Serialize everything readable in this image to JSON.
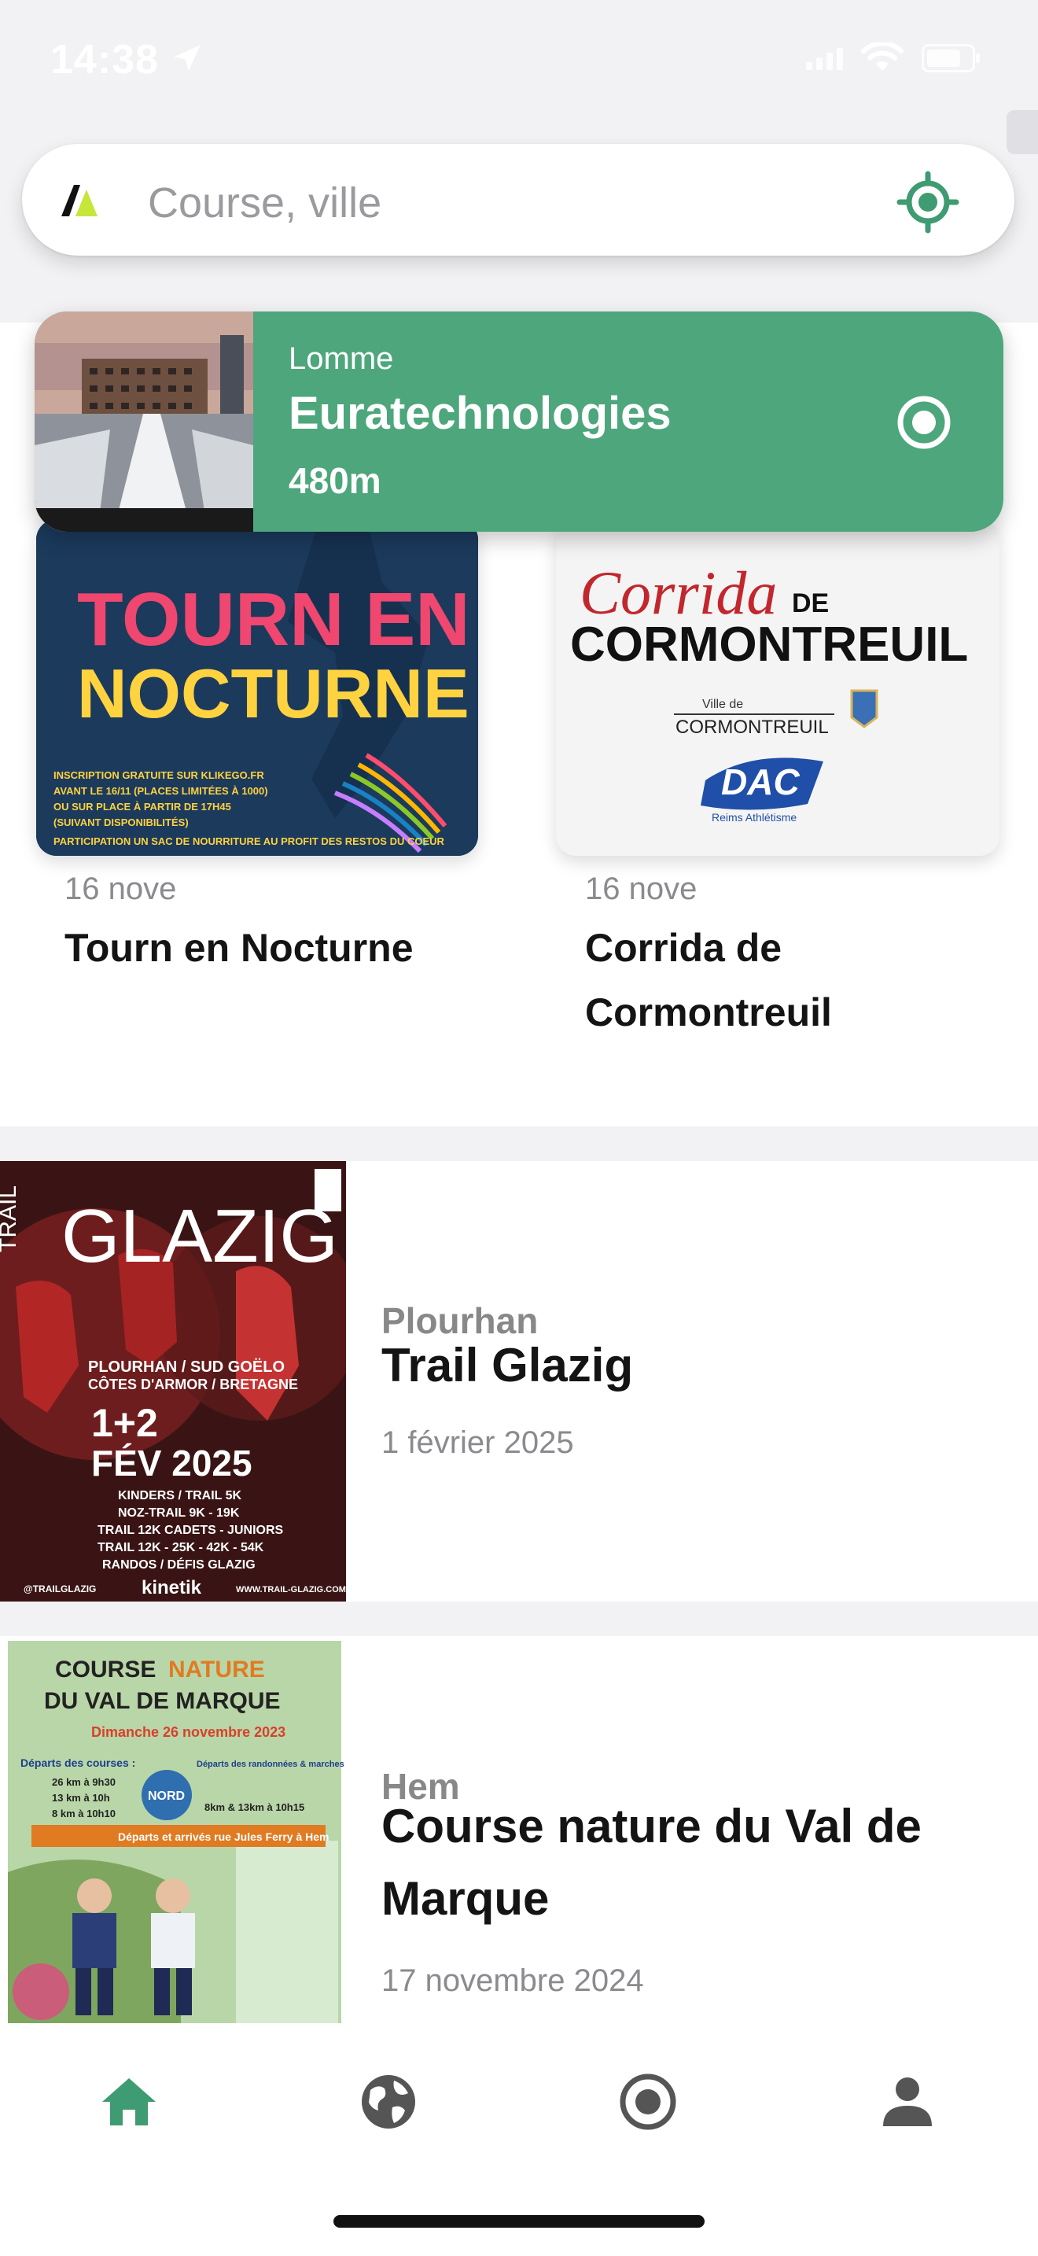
{
  "status_bar": {
    "time": "14:38"
  },
  "search": {
    "placeholder": "Course, ville"
  },
  "nearby": {
    "city": "Lomme",
    "name": "Euratechnologies",
    "distance": "480m"
  },
  "cards": [
    {
      "date": "16 nove",
      "title": "Tourn en Nocturne",
      "poster": {
        "headline_1": "TOURN EN",
        "headline_2": "NOCTURNE",
        "lines": [
          "INSCRIPTION GRATUITE SUR KLIKEGO.FR",
          "AVANT LE 16/11 (PLACES LIMITÉES À 1000)",
          "OU SUR PLACE À PARTIR DE 17H45",
          "(SUIVANT DISPONIBILITÉS)",
          "PARTICIPATION UN SAC DE NOURRITURE AU PROFIT DES RESTOS DU COEUR"
        ]
      }
    },
    {
      "date": "16 nove",
      "title": "Corrida de Cormontreuil",
      "poster": {
        "script": "Corrida",
        "de": "DE",
        "headline": "CORMONTREUIL",
        "ville_de": "Ville de",
        "ville": "CORMONTREUIL",
        "club": "DAC",
        "club_sub": "Reims Athlétisme"
      }
    }
  ],
  "events": [
    {
      "city": "Plourhan",
      "title": "Trail Glazig",
      "date": "1 février 2025",
      "poster": {
        "trail": "TRAIL",
        "name": "GLAZIG",
        "place_1": "PLOURHAN / SUD GOËLO",
        "place_2": "CÔTES D'ARMOR / BRETAGNE",
        "days": "1+2",
        "month": "FÉV 2025",
        "lines": [
          "KINDERS / TRAIL 5K",
          "NOZ-TRAIL 9K - 19K",
          "TRAIL 12K CADETS - JUNIORS",
          "TRAIL 12K - 25K - 42K - 54K",
          "RANDOS / DÉFIS GLAZIG"
        ],
        "footer_left": "@TRAILGLAZIG",
        "footer_mid": "kinetik",
        "footer_right": "WWW.TRAIL-GLAZIG.COM"
      }
    },
    {
      "city": "Hem",
      "title": "Course nature du Val de Marque",
      "date": "17 novembre 2024",
      "poster": {
        "line_1a": "COURSE",
        "line_1b": "NATURE",
        "line_2": "DU VAL DE MARQUE",
        "date": "Dimanche 26 novembre 2023",
        "departs_courses": "Départs des courses :",
        "courses": [
          "26 km à 9h30",
          "13 km à 10h",
          "8 km à 10h10"
        ],
        "departs_randos": "Départs des randonnées & marches nordiques :",
        "randos": "8km & 13km à 10h15",
        "badge": "NORD",
        "arrivals": "Départs et arrivés rue Jules Ferry à Hem"
      }
    }
  ],
  "tabs": [
    {
      "icon": "home-icon",
      "active": true
    },
    {
      "icon": "globe-icon",
      "active": false
    },
    {
      "icon": "record-icon",
      "active": false
    },
    {
      "icon": "profile-icon",
      "active": false
    }
  ],
  "colors": {
    "accent": "#4ea67c",
    "active_tab": "#3e9b72",
    "inactive_tab": "#555555",
    "page_bg": "#f2f2f4"
  }
}
